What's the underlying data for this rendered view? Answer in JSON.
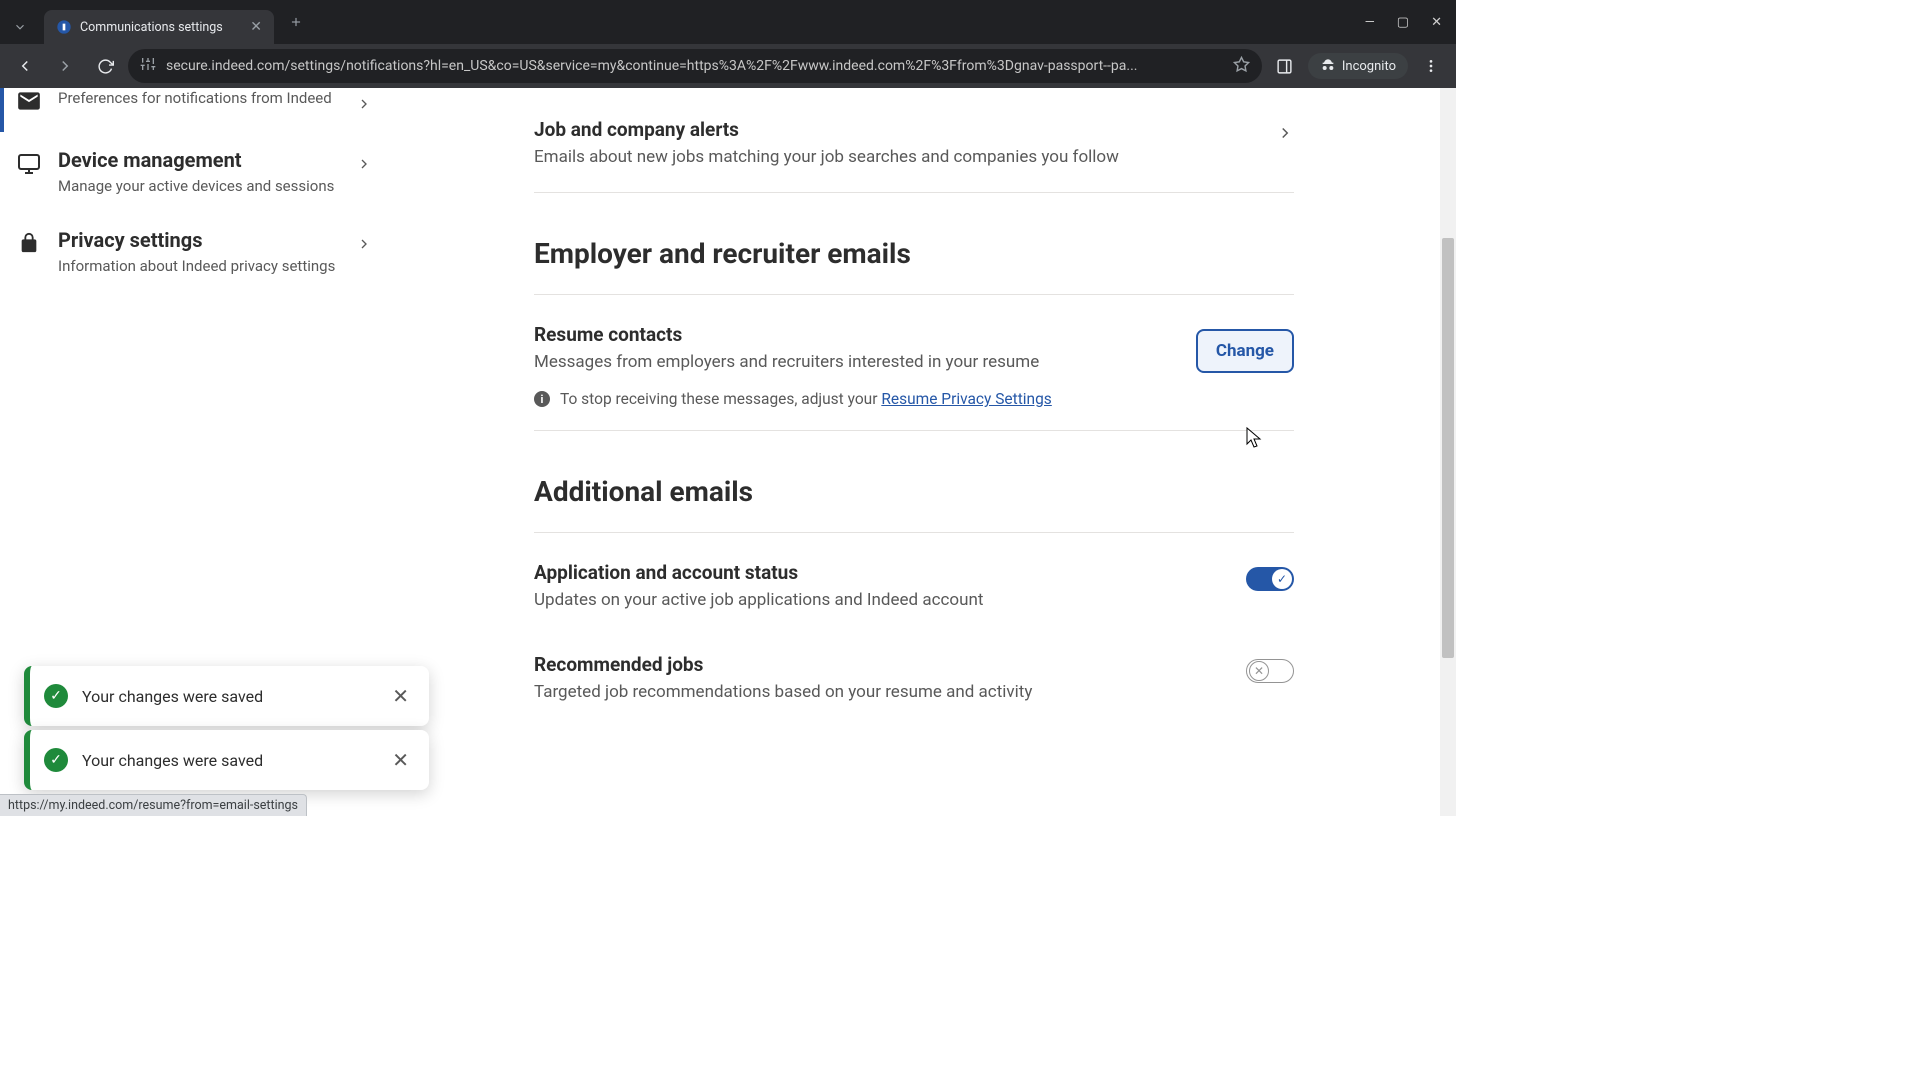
{
  "browser": {
    "tab_title": "Communications settings",
    "url": "secure.indeed.com/settings/notifications?hl=en_US&co=US&service=my&continue=https%3A%2F%2Fwww.indeed.com%2F%3Ffrom%3Dgnav-passport--pa...",
    "incognito_label": "Incognito"
  },
  "sidebar": {
    "items": [
      {
        "title": "",
        "sub": "Preferences for notifications from Indeed"
      },
      {
        "title": "Device management",
        "sub": "Manage your active devices and sessions"
      },
      {
        "title": "Privacy settings",
        "sub": "Information about Indeed privacy settings"
      }
    ]
  },
  "sections": {
    "job_alerts": {
      "title": "Job and company alerts",
      "sub": "Emails about new jobs matching your job searches and companies you follow"
    },
    "employer_heading": "Employer and recruiter emails",
    "resume_contacts": {
      "title": "Resume contacts",
      "sub": "Messages from employers and recruiters interested in your resume",
      "info_prefix": "To stop receiving these messages, adjust your ",
      "info_link": "Resume Privacy Settings",
      "change_label": "Change"
    },
    "additional_heading": "Additional emails",
    "app_status": {
      "title": "Application and account status",
      "sub": "Updates on your active job applications and Indeed account",
      "on": true
    },
    "recommended": {
      "title": "Recommended jobs",
      "sub": "Targeted job recommendations based on your resume and activity",
      "on": false
    }
  },
  "toasts": [
    {
      "msg": "Your changes were saved"
    },
    {
      "msg": "Your changes were saved"
    }
  ],
  "statusbar": "https://my.indeed.com/resume?from=email-settings"
}
